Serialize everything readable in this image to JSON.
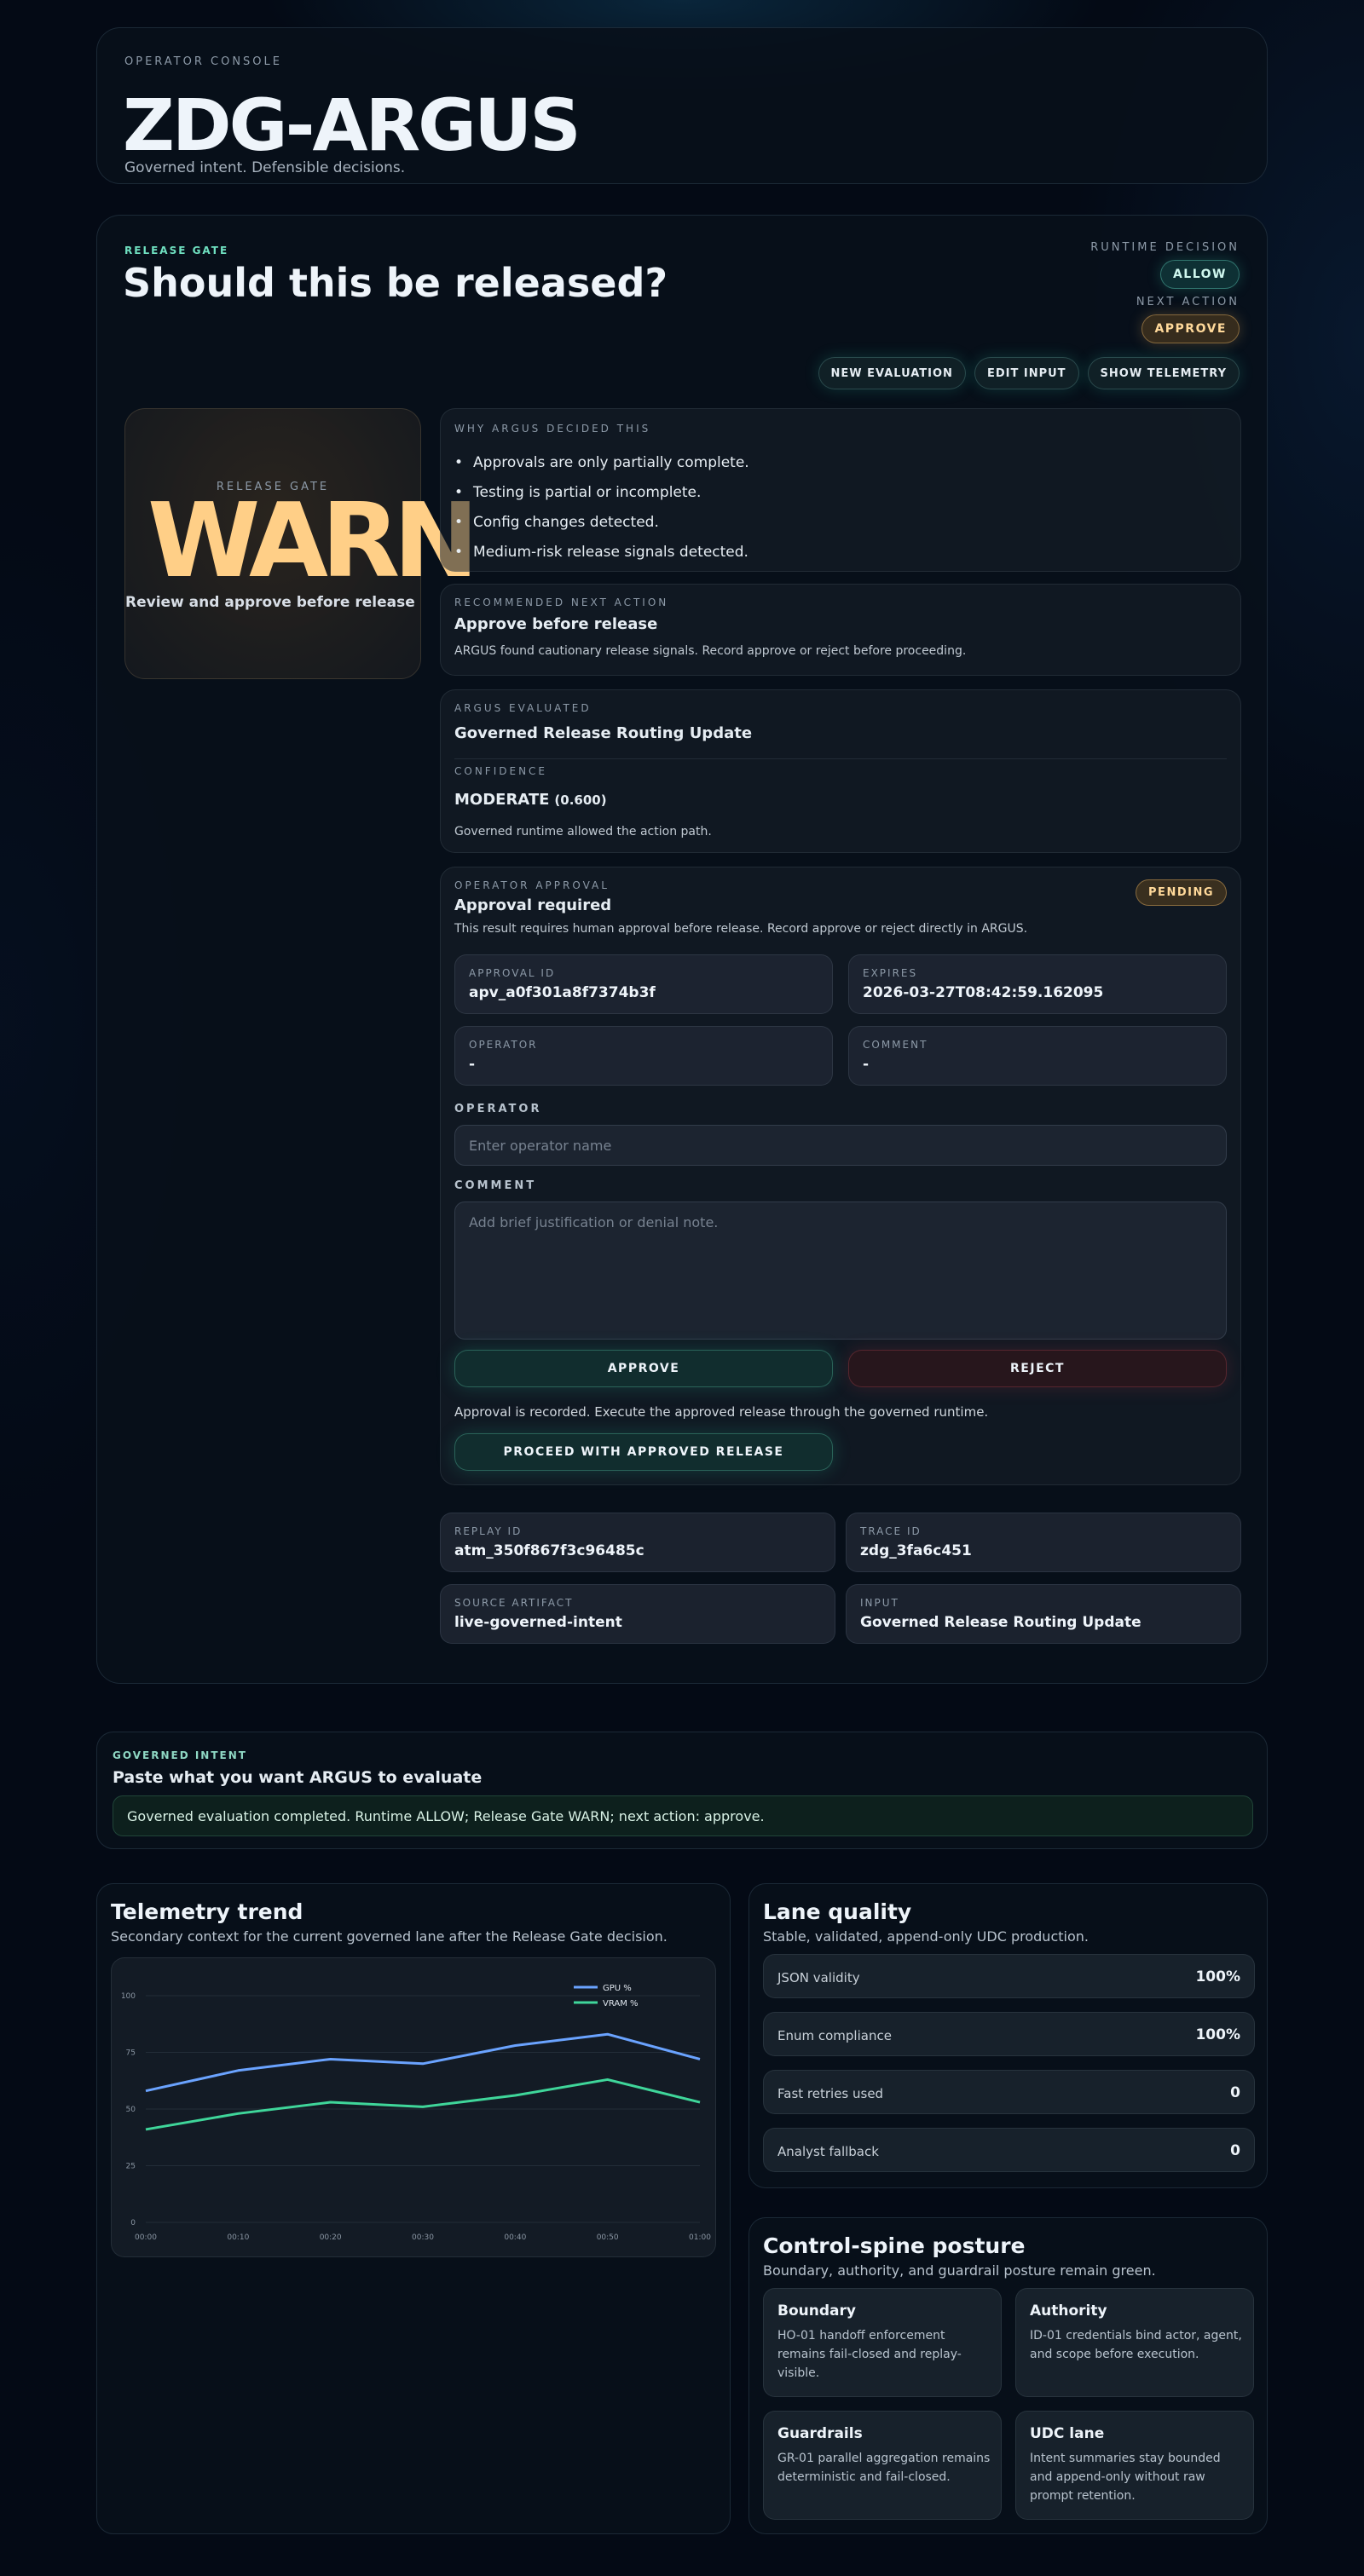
{
  "header": {
    "kicker": "OPERATOR CONSOLE",
    "brand": "ZDG-ARGUS",
    "tagline": "Governed intent. Defensible decisions."
  },
  "release": {
    "kicker": "RELEASE GATE",
    "question": "Should this be released?",
    "runtime_label": "RUNTIME DECISION",
    "runtime_value": "ALLOW",
    "next_label": "NEXT ACTION",
    "next_value": "APPROVE",
    "buttons": {
      "new_eval": "NEW EVALUATION",
      "edit_input": "EDIT INPUT",
      "show_telemetry": "SHOW TELEMETRY"
    },
    "gate_label": "RELEASE GATE",
    "gate_verdict": "WARN",
    "gate_hint": "Review and approve before release",
    "why_label": "WHY ARGUS DECIDED THIS",
    "why_items": [
      "Approvals are only partially complete.",
      "Testing is partial or incomplete.",
      "Config changes detected.",
      "Medium-risk release signals detected."
    ],
    "rec_label": "RECOMMENDED NEXT ACTION",
    "rec_title": "Approve before release",
    "rec_desc": "ARGUS found cautionary release signals. Record approve or reject before proceeding.",
    "eval_label": "ARGUS EVALUATED",
    "eval_name": "Governed Release Routing Update",
    "conf_label": "CONFIDENCE",
    "conf_value": "MODERATE",
    "conf_score": "(0.600)",
    "conf_desc": "Governed runtime allowed the action path."
  },
  "approval": {
    "label": "OPERATOR APPROVAL",
    "title": "Approval required",
    "status": "PENDING",
    "desc": "This result requires human approval before release. Record approve or reject directly in ARGUS.",
    "id_label": "APPROVAL ID",
    "id_value": "apv_a0f301a8f7374b3f",
    "expires_label": "EXPIRES",
    "expires_value": "2026-03-27T08:42:59.162095",
    "operator_label": "OPERATOR",
    "operator_value": "-",
    "comment_label": "COMMENT",
    "comment_value": "-",
    "operator_field_label": "OPERATOR",
    "operator_placeholder": "Enter operator name",
    "comment_field_label": "COMMENT",
    "comment_placeholder": "Add brief justification or denial note.",
    "approve_btn": "APPROVE",
    "reject_btn": "REJECT",
    "note": "Approval is recorded. Execute the approved release through the governed runtime.",
    "proceed_btn": "PROCEED WITH APPROVED RELEASE"
  },
  "artifacts": {
    "replay_label": "REPLAY ID",
    "replay_value": "atm_350f867f3c96485c",
    "trace_label": "TRACE ID",
    "trace_value": "zdg_3fa6c451",
    "source_label": "SOURCE ARTIFACT",
    "source_value": "live-governed-intent",
    "input_label": "INPUT",
    "input_value": "Governed Release Routing Update"
  },
  "intent": {
    "kicker": "GOVERNED INTENT",
    "title": "Paste what you want ARGUS to evaluate",
    "message": "Governed evaluation completed. Runtime ALLOW; Release Gate WARN; next action: approve."
  },
  "telemetry": {
    "title": "Telemetry trend",
    "subtitle": "Secondary context for the current governed lane after the Release Gate decision."
  },
  "chart_data": {
    "type": "line",
    "x": [
      "00:00",
      "00:10",
      "00:20",
      "00:30",
      "00:40",
      "00:50",
      "01:00"
    ],
    "series": [
      {
        "name": "GPU %",
        "values": [
          58,
          67,
          72,
          70,
          78,
          83,
          72
        ],
        "color": "#6aa3ff"
      },
      {
        "name": "VRAM %",
        "values": [
          41,
          48,
          53,
          51,
          56,
          63,
          53
        ],
        "color": "#3fd69a"
      }
    ],
    "yticks": [
      0,
      25,
      50,
      75,
      100
    ],
    "ylim": [
      0,
      100
    ],
    "grid": true,
    "legend": "top-right"
  },
  "lane": {
    "title": "Lane quality",
    "subtitle": "Stable, validated, append-only UDC production.",
    "metrics": [
      {
        "label": "JSON validity",
        "value": "100%"
      },
      {
        "label": "Enum compliance",
        "value": "100%"
      },
      {
        "label": "Fast retries used",
        "value": "0"
      },
      {
        "label": "Analyst fallback",
        "value": "0"
      }
    ]
  },
  "spine": {
    "title": "Control-spine posture",
    "subtitle": "Boundary, authority, and guardrail posture remain green.",
    "tiles": [
      {
        "title": "Boundary",
        "desc": "HO-01 handoff enforcement remains fail-closed and replay-visible."
      },
      {
        "title": "Authority",
        "desc": "ID-01 credentials bind actor, agent, and scope before execution."
      },
      {
        "title": "Guardrails",
        "desc": "GR-01 parallel aggregation remains deterministic and fail-closed."
      },
      {
        "title": "UDC lane",
        "desc": "Intent summaries stay bounded and append-only without raw prompt retention."
      }
    ]
  }
}
